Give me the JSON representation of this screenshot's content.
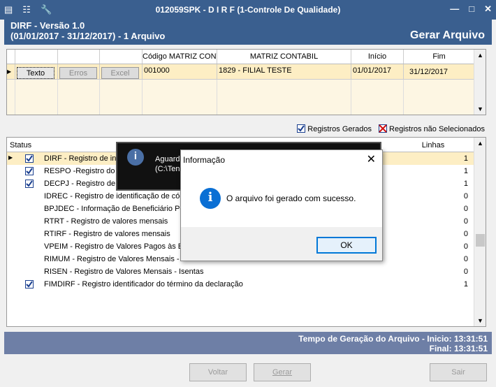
{
  "window": {
    "title": "012059SPK - D I R F (1-Controle De Qualidade)"
  },
  "header": {
    "line1": "DIRF - Versão 1.0",
    "line2": "(01/01/2017 - 31/12/2017) - 1 Arquivo",
    "right_title": "Gerar Arquivo"
  },
  "grid1": {
    "columns": [
      "",
      "",
      "Código MATRIZ CONTA",
      "MATRIZ CONTABIL",
      "Início",
      "Fim"
    ],
    "row": {
      "btn_texto": "Texto",
      "btn_erros": "Erros",
      "btn_excel": "Excel",
      "codigo": "001000",
      "matriz": "1829 - FILIAL TESTE",
      "inicio": "01/01/2017",
      "fim": "31/12/2017"
    }
  },
  "legend": {
    "gerados": "Registros Gerados",
    "nao_selecionados": "Registros não Selecionados"
  },
  "grid2": {
    "col_status": "Status",
    "col_linhas": "Linhas",
    "rows": [
      {
        "desc": "DIRF - Registro de in",
        "checked": true,
        "lines": "1",
        "current": true
      },
      {
        "desc": "RESPO -Registro do R",
        "checked": true,
        "lines": "1"
      },
      {
        "desc": "DECPJ - Registro de i",
        "checked": true,
        "lines": "1"
      },
      {
        "desc": "IDREC - Registro de identificação de cód",
        "checked": false,
        "lines": "0"
      },
      {
        "desc": "BPJDEC - Informação de Beneficiário Pes",
        "checked": false,
        "lines": "0"
      },
      {
        "desc": "RTRT - Registro de valores mensais",
        "checked": false,
        "lines": "0"
      },
      {
        "desc": "RTIRF - Registro de valores mensais",
        "checked": false,
        "lines": "0"
      },
      {
        "desc": "VPEIM - Registro de Valores Pagos às En",
        "checked": false,
        "lines": "0"
      },
      {
        "desc": "RIMUM - Registro de Valores Mensais - I",
        "checked": false,
        "lines": "0"
      },
      {
        "desc": "RISEN - Registro de Valores Mensais - Isentas",
        "checked": false,
        "lines": "0"
      },
      {
        "desc": "FIMDIRF - Registro identificador do término da declaração",
        "checked": true,
        "lines": "1"
      }
    ]
  },
  "statusbar": {
    "line1": "Tempo de Geração do Arquivo - Inicio: 13:31:51",
    "line2": "Final: 13:31:51"
  },
  "buttons": {
    "voltar": "Voltar",
    "gerar": "Gerar",
    "sair": "Sair"
  },
  "progress_popup": {
    "text1": "Aguard",
    "text2": "(C:\\Ten"
  },
  "dialog": {
    "title": "Informação",
    "message": "O arquivo  foi gerado com sucesso.",
    "ok": "OK"
  },
  "colors": {
    "header_bg": "#3a5f8f",
    "statusbar_bg": "#6e7fa6",
    "row_highlight": "#fdeec4"
  }
}
